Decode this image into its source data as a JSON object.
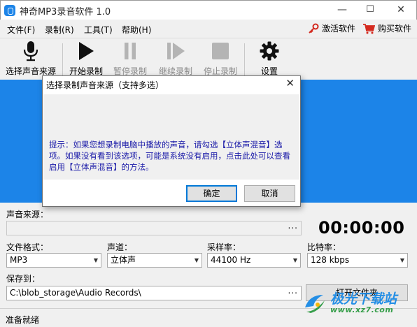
{
  "window": {
    "title": "神奇MP3录音软件 1.0",
    "minimize": "—",
    "maximize": "☐",
    "close": "✕"
  },
  "menu": {
    "items": [
      "文件(F)",
      "录制(R)",
      "工具(T)",
      "帮助(H)"
    ],
    "activate": "激活软件",
    "buy": "购买软件"
  },
  "toolbar": {
    "select_source": "选择声音来源",
    "start": "开始录制",
    "pause": "暂停录制",
    "resume": "继续录制",
    "stop": "停止录制",
    "settings": "设置"
  },
  "panel": {
    "source_label": "声音来源：",
    "source_value": "",
    "source_browse": "...",
    "timer": "00:00:00",
    "format_label": "文件格式：",
    "format_value": "MP3",
    "channel_label": "声道：",
    "channel_value": "立体声",
    "samplerate_label": "采样率：",
    "samplerate_value": "44100 Hz",
    "bitrate_label": "比特率：",
    "bitrate_value": "128 kbps",
    "saveto_label": "保存到：",
    "saveto_value": "C:\\blob_storage\\Audio Records\\",
    "saveto_browse": "...",
    "open_folder": "打开文件夹"
  },
  "status": {
    "text": "准备就绪"
  },
  "dialog": {
    "title": "选择录制声音来源（支持多选）",
    "close": "✕",
    "hint": "提示：如果您想录制电脑中播放的声音，请勾选【立体声混音】选项。如果没有看到该选项，可能是系统没有启用，点击此处可以查看启用【立体声混音】的方法。",
    "ok": "确定",
    "cancel": "取消"
  },
  "watermark": {
    "cn": "极光下载站",
    "en": "www.xz7.com"
  },
  "colors": {
    "accent_blue": "#1c84e8",
    "hint_text": "#1a1aa8",
    "watermark_blue": "#1a8ae6",
    "watermark_green": "#2d9a42"
  },
  "icons": [
    "app-icon",
    "key-icon",
    "cart-icon",
    "microphone-icon",
    "play-icon",
    "pause-icon",
    "resume-icon",
    "stop-icon",
    "gear-icon",
    "chevron-down-icon",
    "close-icon"
  ]
}
